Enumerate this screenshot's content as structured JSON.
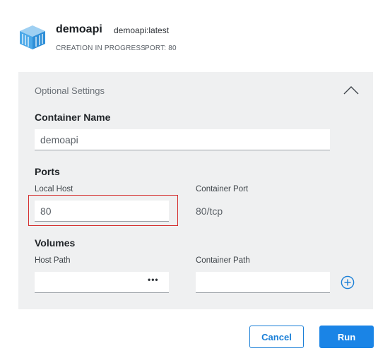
{
  "header": {
    "container_name": "demoapi",
    "image_tag": "demoapi:latest",
    "status": "CREATION IN PROGRESS",
    "port": "PORT: 80",
    "logo_icon": "container-icon"
  },
  "optional_settings": {
    "title": "Optional Settings",
    "collapse_icon": "chevron-up-icon",
    "container_name": {
      "heading": "Container Name",
      "value": "demoapi"
    },
    "ports": {
      "heading": "Ports",
      "local_host_label": "Local Host",
      "local_host_value": "80",
      "container_port_label": "Container Port",
      "container_port_value": "80/tcp"
    },
    "volumes": {
      "heading": "Volumes",
      "host_path_label": "Host Path",
      "host_path_value": "",
      "browse_label": "•••",
      "container_path_label": "Container Path",
      "container_path_value": "",
      "add_icon": "plus-circle-icon"
    }
  },
  "actions": {
    "cancel_label": "Cancel",
    "run_label": "Run"
  },
  "colors": {
    "accent": "#1a84e6",
    "highlight": "#d42b2b",
    "panel_bg": "#eff0f1"
  }
}
